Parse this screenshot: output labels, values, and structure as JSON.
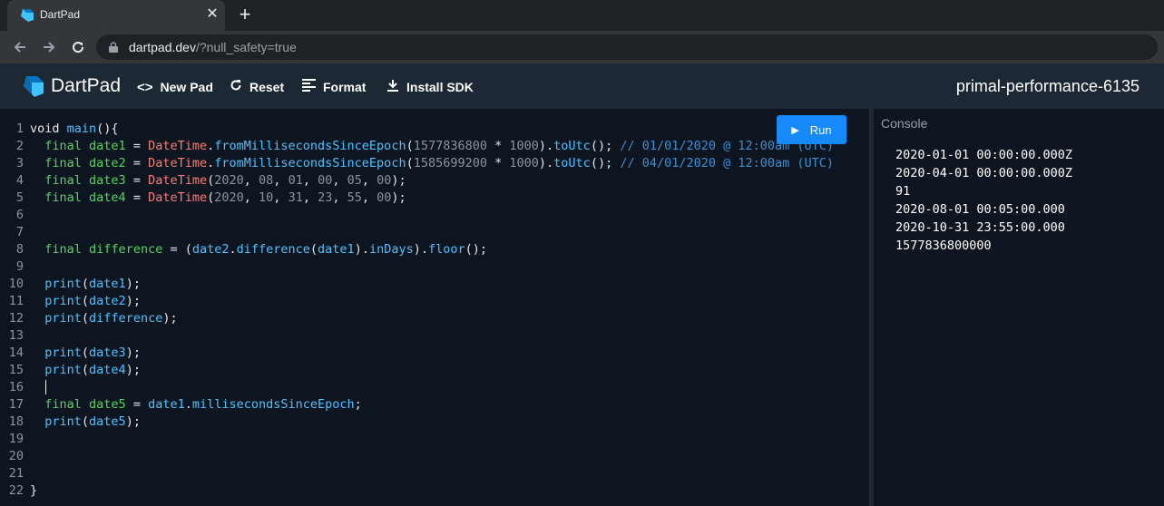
{
  "browser": {
    "tab_title": "DartPad",
    "close_glyph": "✕",
    "newtab_glyph": "+",
    "url_host": "dartpad.dev",
    "url_path": "/?null_safety=true"
  },
  "header": {
    "brand": "DartPad",
    "new_pad": "New Pad",
    "reset": "Reset",
    "format": "Format",
    "install_sdk": "Install SDK",
    "pad_name": "primal-performance-6135"
  },
  "editor": {
    "line_numbers": [
      "1",
      "2",
      "3",
      "4",
      "5",
      "6",
      "7",
      "8",
      "9",
      "10",
      "11",
      "12",
      "13",
      "14",
      "15",
      "16",
      "17",
      "18",
      "19",
      "20",
      "21",
      "22"
    ],
    "run_label": "Run"
  },
  "console": {
    "title": "Console",
    "lines": [
      "2020-01-01 00:00:00.000Z",
      "2020-04-01 00:00:00.000Z",
      "91",
      "2020-08-01 00:05:00.000",
      "2020-10-31 23:55:00.000",
      "1577836800000"
    ]
  },
  "colors": {
    "accent": "#168afd",
    "header_bg": "#1c2834",
    "editor_bg": "#0d1520"
  },
  "icons": {
    "back": "arrow-left-icon",
    "forward": "arrow-right-icon",
    "reload": "reload-icon",
    "lock": "lock-icon",
    "new_pad": "code-brackets-icon",
    "reset": "refresh-icon",
    "format": "align-left-icon",
    "install": "download-icon",
    "run": "play-icon"
  }
}
